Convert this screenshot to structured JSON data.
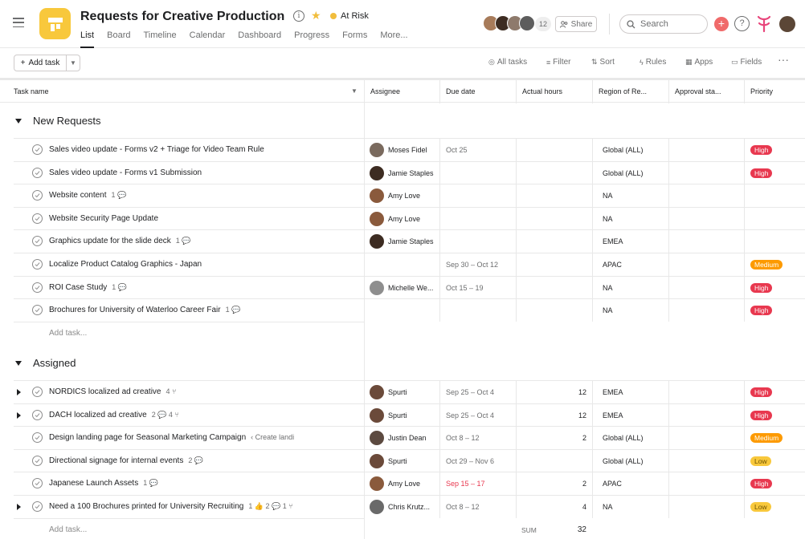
{
  "project": {
    "title": "Requests for Creative Production",
    "status": "At Risk",
    "status_color": "#f1bd3c",
    "icon_color": "#f8c83c"
  },
  "tabs": [
    "List",
    "Board",
    "Timeline",
    "Calendar",
    "Dashboard",
    "Progress",
    "Forms",
    "More..."
  ],
  "header": {
    "member_count": "12",
    "share_label": "Share",
    "search_placeholder": "Search"
  },
  "toolbar": {
    "add_task": "Add task",
    "all_tasks": "All tasks",
    "filter": "Filter",
    "sort": "Sort",
    "rules": "Rules",
    "apps": "Apps",
    "fields": "Fields"
  },
  "columns": [
    "Task name",
    "Assignee",
    "Due date",
    "Actual hours",
    "Region of Re...",
    "Approval sta...",
    "Priority"
  ],
  "sections": [
    {
      "title": "New Requests",
      "add_task": "Add task...",
      "tasks": [
        {
          "name": "Sales video update - Forms v2 + Triage for Video Team Rule",
          "meta": "",
          "expandable": false,
          "assignee": "Moses Fidel",
          "avatar": "#7a6a5e",
          "due": "Oct 25",
          "overdue": false,
          "hours": "",
          "region": "Global (ALL)",
          "priority": "High"
        },
        {
          "name": "Sales video update - Forms v1 Submission",
          "meta": "",
          "expandable": false,
          "assignee": "Jamie Staples",
          "avatar": "#3d2c22",
          "due": "",
          "overdue": false,
          "hours": "",
          "region": "Global (ALL)",
          "priority": "High"
        },
        {
          "name": "Website content",
          "meta": "1 💬",
          "expandable": false,
          "assignee": "Amy Love",
          "avatar": "#8a5a3c",
          "due": "",
          "overdue": false,
          "hours": "",
          "region": "NA",
          "priority": ""
        },
        {
          "name": "Website Security Page Update",
          "meta": "",
          "expandable": false,
          "assignee": "Amy Love",
          "avatar": "#8a5a3c",
          "due": "",
          "overdue": false,
          "hours": "",
          "region": "NA",
          "priority": ""
        },
        {
          "name": "Graphics update for the slide deck",
          "meta": "1 💬",
          "expandable": false,
          "assignee": "Jamie Staples",
          "avatar": "#3d2c22",
          "due": "",
          "overdue": false,
          "hours": "",
          "region": "EMEA",
          "priority": ""
        },
        {
          "name": "Localize Product Catalog Graphics - Japan",
          "meta": "",
          "expandable": false,
          "assignee": "",
          "avatar": "",
          "due": "Sep 30 – Oct 12",
          "overdue": false,
          "hours": "",
          "region": "APAC",
          "priority": "Medium"
        },
        {
          "name": "ROI Case Study",
          "meta": "1 💬",
          "expandable": false,
          "assignee": "Michelle We...",
          "avatar": "#8e8e8e",
          "due": "Oct 15 – 19",
          "overdue": false,
          "hours": "",
          "region": "NA",
          "priority": "High"
        },
        {
          "name": "Brochures for University of Waterloo Career Fair",
          "meta": "1 💬",
          "expandable": false,
          "assignee": "",
          "avatar": "",
          "due": "",
          "overdue": false,
          "hours": "",
          "region": "NA",
          "priority": "High"
        }
      ]
    },
    {
      "title": "Assigned",
      "add_task": "Add task...",
      "tasks": [
        {
          "name": "NORDICS localized ad creative",
          "meta": "4 ⑂",
          "expandable": true,
          "assignee": "Spurti",
          "avatar": "#6b4a3a",
          "due": "Sep 25 – Oct 4",
          "overdue": false,
          "hours": "12",
          "region": "EMEA",
          "priority": "High"
        },
        {
          "name": "DACH localized ad creative",
          "meta": "2 💬  4 ⑂",
          "expandable": true,
          "assignee": "Spurti",
          "avatar": "#6b4a3a",
          "due": "Sep 25 – Oct 4",
          "overdue": false,
          "hours": "12",
          "region": "EMEA",
          "priority": "High"
        },
        {
          "name": "Design landing page for Seasonal Marketing Campaign",
          "meta": "‹ Create landi",
          "expandable": false,
          "assignee": "Justin Dean",
          "avatar": "#5c4a40",
          "due": "Oct 8 – 12",
          "overdue": false,
          "hours": "2",
          "region": "Global (ALL)",
          "priority": "Medium"
        },
        {
          "name": "Directional signage for internal events",
          "meta": "2 💬",
          "expandable": false,
          "assignee": "Spurti",
          "avatar": "#6b4a3a",
          "due": "Oct 29 – Nov 6",
          "overdue": false,
          "hours": "",
          "region": "Global (ALL)",
          "priority": "Low"
        },
        {
          "name": "Japanese Launch Assets",
          "meta": "1 💬",
          "expandable": false,
          "assignee": "Amy Love",
          "avatar": "#8a5a3c",
          "due": "Sep 15 – 17",
          "overdue": true,
          "hours": "2",
          "region": "APAC",
          "priority": "High"
        },
        {
          "name": "Need a 100 Brochures printed for University Recruiting",
          "meta": "1 👍  2 💬  1 ⑂",
          "expandable": true,
          "assignee": "Chris Krutz...",
          "avatar": "#6a6a6a",
          "due": "Oct 8 – 12",
          "overdue": false,
          "hours": "4",
          "region": "NA",
          "priority": "Low"
        }
      ]
    }
  ],
  "footer": {
    "sum_label": "SUM",
    "sum_value": "32"
  }
}
